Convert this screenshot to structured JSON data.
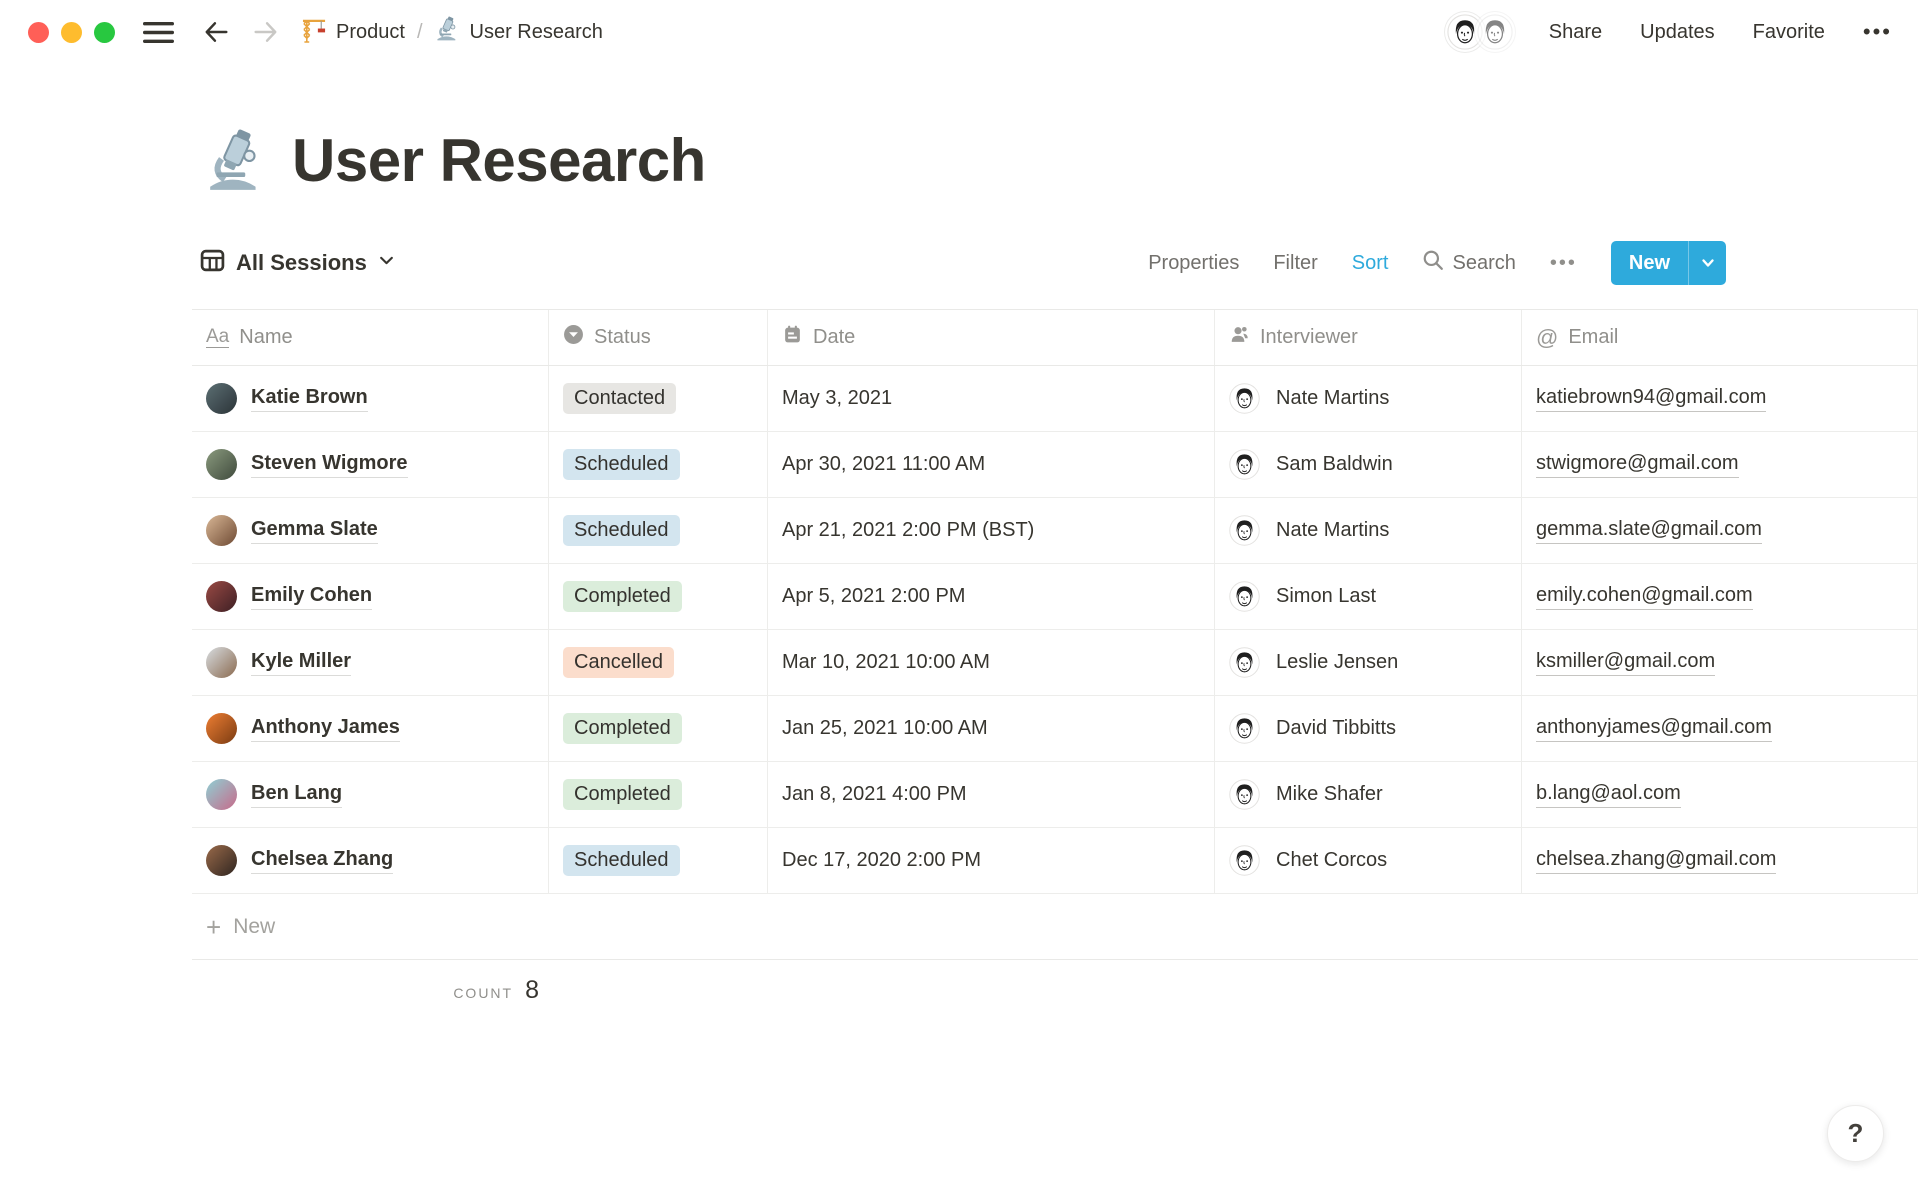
{
  "window": {
    "traffic_lights": {
      "red": "#FF5F57",
      "yellow": "#FEBC2E",
      "green": "#28C840"
    }
  },
  "topbar": {
    "breadcrumb": [
      {
        "icon": "crane-icon",
        "label": "Product"
      },
      {
        "icon": "microscope-icon",
        "label": "User Research"
      }
    ],
    "separator": "/",
    "actions": [
      "Share",
      "Updates",
      "Favorite"
    ],
    "more_label": "•••"
  },
  "page": {
    "icon": "microscope-icon",
    "title": "User Research"
  },
  "view_bar": {
    "view_name": "All Sessions",
    "properties_label": "Properties",
    "filter_label": "Filter",
    "sort_label": "Sort",
    "search_label": "Search",
    "more_label": "•••",
    "new_label": "New"
  },
  "table": {
    "columns": [
      {
        "icon": "text-icon",
        "label": "Name"
      },
      {
        "icon": "select-icon",
        "label": "Status"
      },
      {
        "icon": "calendar-icon",
        "label": "Date"
      },
      {
        "icon": "person-icon",
        "label": "Interviewer"
      },
      {
        "icon": "at-icon",
        "label": "Email"
      }
    ],
    "rows": [
      {
        "name": "Katie Brown",
        "avatar_colors": [
          "#5c6f74",
          "#2b3337"
        ],
        "status": "Contacted",
        "badge_color": "gray",
        "date": "May 3, 2021",
        "interviewer": "Nate Martins",
        "email": "katiebrown94@gmail.com"
      },
      {
        "name": "Steven Wigmore",
        "avatar_colors": [
          "#8a9a7e",
          "#3f4a3c"
        ],
        "status": "Scheduled",
        "badge_color": "blue",
        "date": "Apr 30, 2021 11:00 AM",
        "interviewer": "Sam Baldwin",
        "email": "stwigmore@gmail.com"
      },
      {
        "name": "Gemma Slate",
        "avatar_colors": [
          "#d9b796",
          "#6e4a33"
        ],
        "status": "Scheduled",
        "badge_color": "blue",
        "date": "Apr 21, 2021 2:00 PM (BST)",
        "interviewer": "Nate Martins",
        "email": "gemma.slate@gmail.com"
      },
      {
        "name": "Emily Cohen",
        "avatar_colors": [
          "#9a4a44",
          "#3d1f24"
        ],
        "status": "Completed",
        "badge_color": "green",
        "date": "Apr 5, 2021 2:00 PM",
        "interviewer": "Simon Last",
        "email": "emily.cohen@gmail.com"
      },
      {
        "name": "Kyle Miller",
        "avatar_colors": [
          "#d8dde1",
          "#8a6a4f"
        ],
        "status": "Cancelled",
        "badge_color": "peach",
        "date": "Mar 10, 2021 10:00 AM",
        "interviewer": "Leslie Jensen",
        "email": "ksmiller@gmail.com"
      },
      {
        "name": "Anthony James",
        "avatar_colors": [
          "#ee7e33",
          "#7a3b12"
        ],
        "status": "Completed",
        "badge_color": "green",
        "date": "Jan 25, 2021 10:00 AM",
        "interviewer": "David Tibbitts",
        "email": "anthonyjames@gmail.com"
      },
      {
        "name": "Ben Lang",
        "avatar_colors": [
          "#8fd0d4",
          "#c76a8a"
        ],
        "status": "Completed",
        "badge_color": "green",
        "date": "Jan 8, 2021 4:00 PM",
        "interviewer": "Mike Shafer",
        "email": "b.lang@aol.com"
      },
      {
        "name": "Chelsea Zhang",
        "avatar_colors": [
          "#9a6a4a",
          "#2f2520"
        ],
        "status": "Scheduled",
        "badge_color": "blue",
        "date": "Dec 17, 2020 2:00 PM",
        "interviewer": "Chet Corcos",
        "email": "chelsea.zhang@gmail.com"
      }
    ],
    "new_row_label": "New",
    "count_label": "COUNT",
    "count_value": "8"
  },
  "colors": {
    "accent": "#2EAADC",
    "badges": {
      "gray": "#E7E6E3",
      "blue": "#D3E5EF",
      "green": "#DBEDDB",
      "peach": "#FBDDCC"
    }
  },
  "help": {
    "label": "?"
  }
}
